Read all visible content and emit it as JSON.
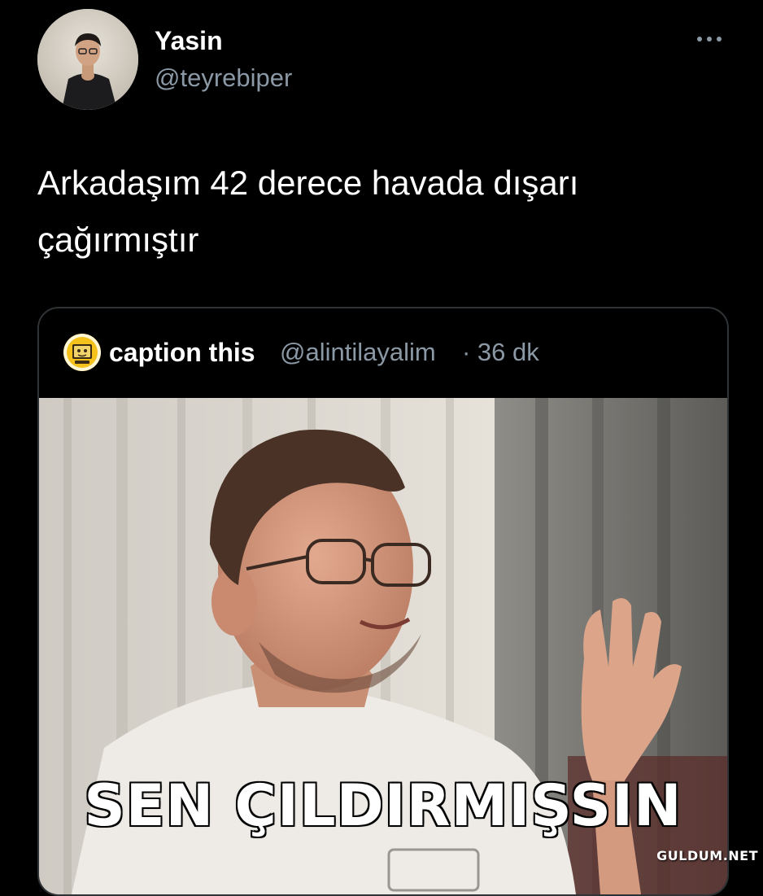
{
  "tweet": {
    "author": {
      "display_name": "Yasin",
      "handle": "@teyrebiper"
    },
    "more_icon": "more-horizontal-icon",
    "text_line1": "Arkadaşım 42 derece havada dışarı",
    "text_line2": "çağırmıştır"
  },
  "quoted_tweet": {
    "display_name": "caption this",
    "handle": "@alintilayalim",
    "time": "· 36 dk",
    "media": {
      "caption": "SEN ÇILDIRMIŞSIN"
    }
  },
  "watermark": "GULDUM.NET",
  "colors": {
    "background": "#000000",
    "primary_text": "#ffffff",
    "secondary_text": "#8b98a5",
    "border": "#2f3336"
  }
}
